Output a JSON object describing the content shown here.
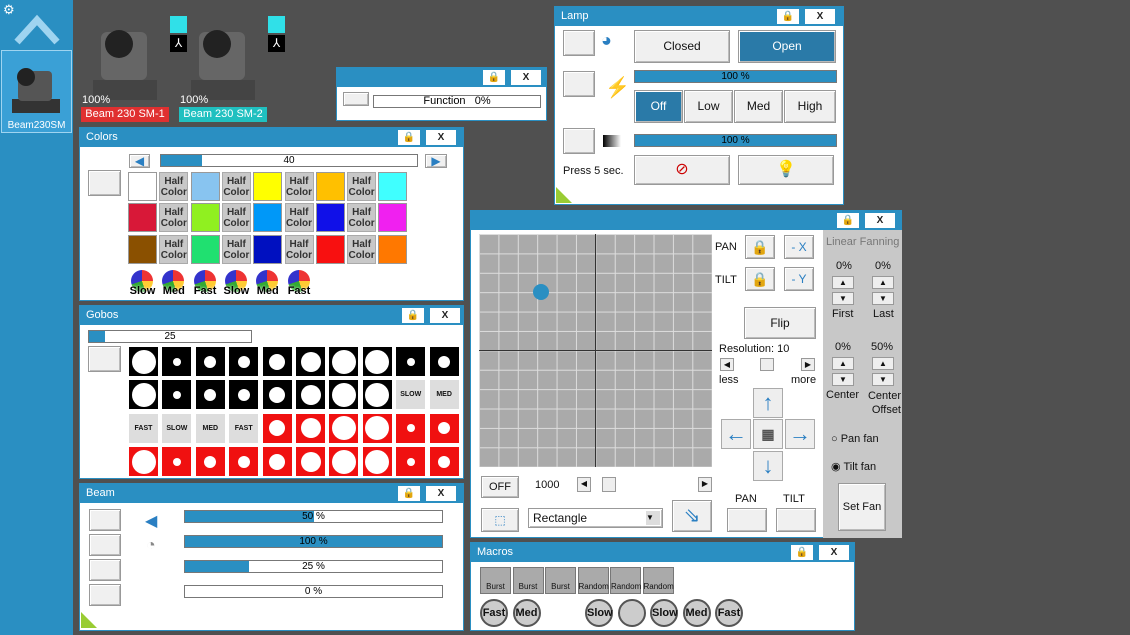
{
  "sidebar": {
    "item_label": "Beam230SM"
  },
  "fixtures": [
    {
      "pct": "100%",
      "name": "Beam 230 SM-1",
      "color": "#e03030"
    },
    {
      "pct": "100%",
      "name": "Beam 230 SM-2",
      "color": "#20c0c0"
    }
  ],
  "function_win": {
    "label": "Function",
    "value": "0%"
  },
  "lamp": {
    "title": "Lamp",
    "closed": "Closed",
    "open": "Open",
    "bar1": "100 %",
    "off": "Off",
    "low": "Low",
    "med": "Med",
    "high": "High",
    "bar2": "100 %",
    "press": "Press 5 sec."
  },
  "colors": {
    "title": "Colors",
    "slider_value": "40",
    "half": "Half Color",
    "swatches": [
      "#ffffff",
      "#88c4f0",
      "#ffff00",
      "#ffc000",
      "#40ffff",
      "#d81838",
      "#90f020",
      "#0098f8",
      "#1010e8",
      "#f020f0",
      "#8a5000",
      "#20e070",
      "#0010c0",
      "#f81010",
      "#ff7800"
    ],
    "speeds": [
      "Slow",
      "Med",
      "Fast",
      "Slow",
      "Med",
      "Fast"
    ]
  },
  "gobos": {
    "title": "Gobos",
    "value": "25",
    "labels": [
      "SLOW",
      "MED",
      "FAST",
      "SLOW",
      "MED",
      "FAST"
    ]
  },
  "beam": {
    "title": "Beam",
    "bars": [
      {
        "text": "50 %",
        "v": 50
      },
      {
        "text": "100 %",
        "v": 100
      },
      {
        "text": "25 %",
        "v": 25
      },
      {
        "text": "0 %",
        "v": 0
      }
    ]
  },
  "pantilt": {
    "pan": "PAN",
    "tilt": "TILT",
    "x_btn": "- X",
    "y_btn": "- Y",
    "flip": "Flip",
    "resolution": "Resolution: 10",
    "less": "less",
    "more": "more",
    "off": "OFF",
    "value": "1000",
    "shape": "Rectangle",
    "pan_lbl": "PAN",
    "tilt_lbl": "TILT",
    "fan_title": "Linear Fanning",
    "first_pct": "0%",
    "last_pct": "0%",
    "first": "First",
    "last": "Last",
    "center_pct": "0%",
    "offset_pct": "50%",
    "center": "Center",
    "center_offset": "Center Offset",
    "pan_fan": "Pan fan",
    "tilt_fan": "Tilt fan",
    "set_fan": "Set Fan"
  },
  "macros": {
    "title": "Macros",
    "top": [
      "Burst",
      "Burst",
      "Burst",
      "Random",
      "Random",
      "Random"
    ],
    "bottom": [
      "Fast",
      "Med",
      "Slow",
      "",
      "Slow",
      "Med",
      "Fast"
    ]
  },
  "icons": {
    "lock": "lock-icon",
    "close": "close-icon"
  }
}
